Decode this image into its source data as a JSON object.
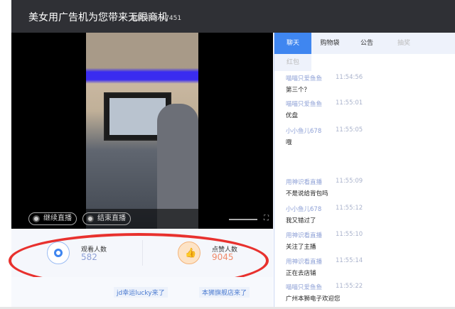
{
  "header": {
    "title": "美女用广告机为您带来无限商机",
    "room_id": "直播间ID: 47451"
  },
  "video": {
    "continue_label": "继续直播",
    "end_label": "结束直播"
  },
  "stats": {
    "viewers_label": "观看人数",
    "viewers": "582",
    "likes_label": "点赞人数",
    "likes": "9045",
    "accent_view": "#3f86f0",
    "accent_like": "#f07a3c",
    "highlight": "#e8312e"
  },
  "entries": [
    "jd幸运lucky来了",
    "本狮旗舰店来了"
  ],
  "tabs": [
    "聊天",
    "购物袋",
    "公告",
    "抽奖"
  ],
  "tab_row2": "红包",
  "messages": [
    {
      "user": "喵喵只爱鱼鱼",
      "time": "11:54:56",
      "text": "第三个？"
    },
    {
      "user": "喵喵只爱鱼鱼",
      "time": "11:55:01",
      "text": "优盘"
    },
    {
      "user": "小小鱼儿678",
      "time": "11:55:05",
      "text": "哦"
    },
    {
      "user": "用神识看直播",
      "time": "11:55:09",
      "text": "不是说给背包吗"
    },
    {
      "user": "小小鱼儿678",
      "time": "11:55:12",
      "text": "我又错过了"
    },
    {
      "user": "用神识看直播",
      "time": "11:55:10",
      "text": "关注了主播"
    },
    {
      "user": "用神识看直播",
      "time": "11:55:14",
      "text": "正在去店铺"
    },
    {
      "user": "喵喵只爱鱼鱼",
      "time": "11:55:22",
      "text": "广州本狮电子欢迎您"
    }
  ]
}
